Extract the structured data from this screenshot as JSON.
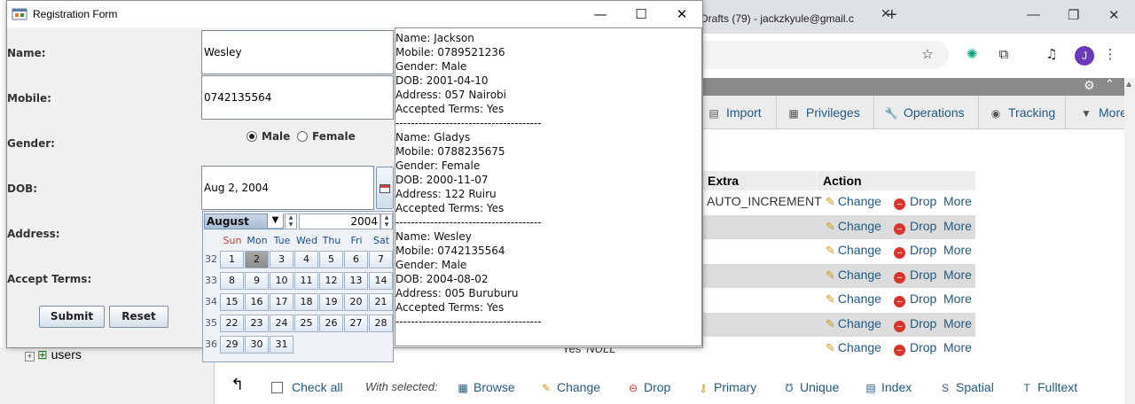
{
  "window": {
    "title": "Registration Form",
    "minimize": "—",
    "maximize": "☐",
    "close": "✕"
  },
  "form": {
    "name_label": "Name:",
    "name_value": "Wesley",
    "mobile_label": "Mobile:",
    "mobile_value": "0742135564",
    "gender_label": "Gender:",
    "gender_options": [
      "Male",
      "Female"
    ],
    "gender_selected": "Male",
    "dob_label": "DOB:",
    "dob_value": "Aug 2, 2004",
    "address_label": "Address:",
    "terms_label": "Accept Terms:",
    "submit_label": "Submit",
    "reset_label": "Reset"
  },
  "calendar": {
    "month": "August",
    "year": "2004",
    "weekdays": [
      "Sun",
      "Mon",
      "Tue",
      "Wed",
      "Thu",
      "Fri",
      "Sat"
    ],
    "weeks": [
      {
        "num": "32",
        "days": [
          "1",
          "2",
          "3",
          "4",
          "5",
          "6",
          "7"
        ]
      },
      {
        "num": "33",
        "days": [
          "8",
          "9",
          "10",
          "11",
          "12",
          "13",
          "14"
        ]
      },
      {
        "num": "34",
        "days": [
          "15",
          "16",
          "17",
          "18",
          "19",
          "20",
          "21"
        ]
      },
      {
        "num": "35",
        "days": [
          "22",
          "23",
          "24",
          "25",
          "26",
          "27",
          "28"
        ]
      },
      {
        "num": "36",
        "days": [
          "29",
          "30",
          "31"
        ]
      }
    ],
    "selected_day": "2"
  },
  "output": [
    "Name: Jackson",
    "Mobile: 0789521236",
    "Gender: Male",
    "DOB: 2001-04-10",
    "Address: 057 Nairobi",
    "Accepted Terms: Yes",
    "--------------------------------------",
    "Name: Gladys",
    "Mobile: 0788235675",
    "Gender: Female",
    "DOB: 2000-11-07",
    "Address: 122 Ruiru",
    "Accepted Terms: Yes",
    "--------------------------------------",
    "Name: Wesley",
    "Mobile: 0742135564",
    "Gender: Male",
    "DOB: 2004-08-02",
    "Address: 005 Buruburu",
    "Accepted Terms: Yes",
    "--------------------------------------"
  ],
  "browser": {
    "tab_title": "Drafts (79) - jackzkyule@gmail.c",
    "tab_close": "✕",
    "new_tab": "+",
    "avatar_letter": "J",
    "win_min": "—",
    "win_restore": "❐",
    "win_close": "✕"
  },
  "pma": {
    "tabs": [
      "Import",
      "Privileges",
      "Operations",
      "Tracking",
      "More"
    ],
    "table_headers": {
      "extra": "Extra",
      "action": "Action"
    },
    "extra_first": "AUTO_INCREMENT",
    "action_labels": {
      "change": "Change",
      "drop": "Drop",
      "more": "More"
    },
    "row_count": 7,
    "yes_text": "Yes",
    "null_text": "NULL",
    "tree_item": "users",
    "bottom": {
      "check_all": "Check all",
      "with_selected": "With selected:",
      "actions": [
        "Browse",
        "Change",
        "Drop",
        "Primary",
        "Unique",
        "Index",
        "Spatial",
        "Fulltext"
      ]
    }
  },
  "colors": {
    "link": "#235a81",
    "drop": "#d9342b",
    "selected_day": "#999999"
  }
}
